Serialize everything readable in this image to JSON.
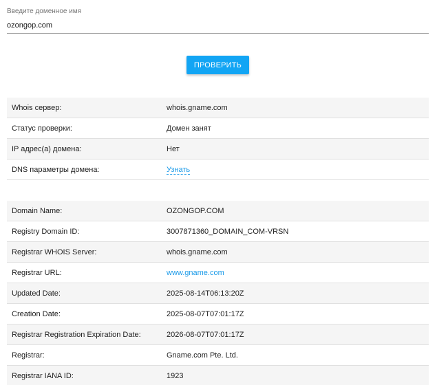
{
  "domain_form": {
    "label": "Введите доменное имя",
    "value": "ozongop.com",
    "button_label": "ПРОВЕРИТЬ"
  },
  "summary_rows": [
    {
      "key": "Whois сервер:",
      "value": "whois.gname.com"
    },
    {
      "key": "Статус проверки:",
      "value": "Домен занят"
    },
    {
      "key": "IP адрес(а) домена:",
      "value": "Нет"
    },
    {
      "key": "DNS параметры домена:",
      "value": "Узнать"
    }
  ],
  "whois_rows": [
    {
      "key": "Domain Name:",
      "value": "OZONGOP.COM"
    },
    {
      "key": "Registry Domain ID:",
      "value": "3007871360_DOMAIN_COM-VRSN"
    },
    {
      "key": "Registrar WHOIS Server:",
      "value": "whois.gname.com"
    },
    {
      "key": "Registrar URL:",
      "value": "www.gname.com"
    },
    {
      "key": "Updated Date:",
      "value": "2025-08-14T06:13:20Z"
    },
    {
      "key": "Creation Date:",
      "value": "2025-08-07T07:01:17Z"
    },
    {
      "key": "Registrar Registration Expiration Date:",
      "value": "2026-08-07T07:01:17Z"
    },
    {
      "key": "Registrar:",
      "value": "Gname.com Pte. Ltd."
    },
    {
      "key": "Registrar IANA ID:",
      "value": "1923"
    }
  ],
  "colors": {
    "accent": "#12a5f4",
    "link": "#1a9ae8",
    "row_stripe": "#f5f5f5"
  }
}
